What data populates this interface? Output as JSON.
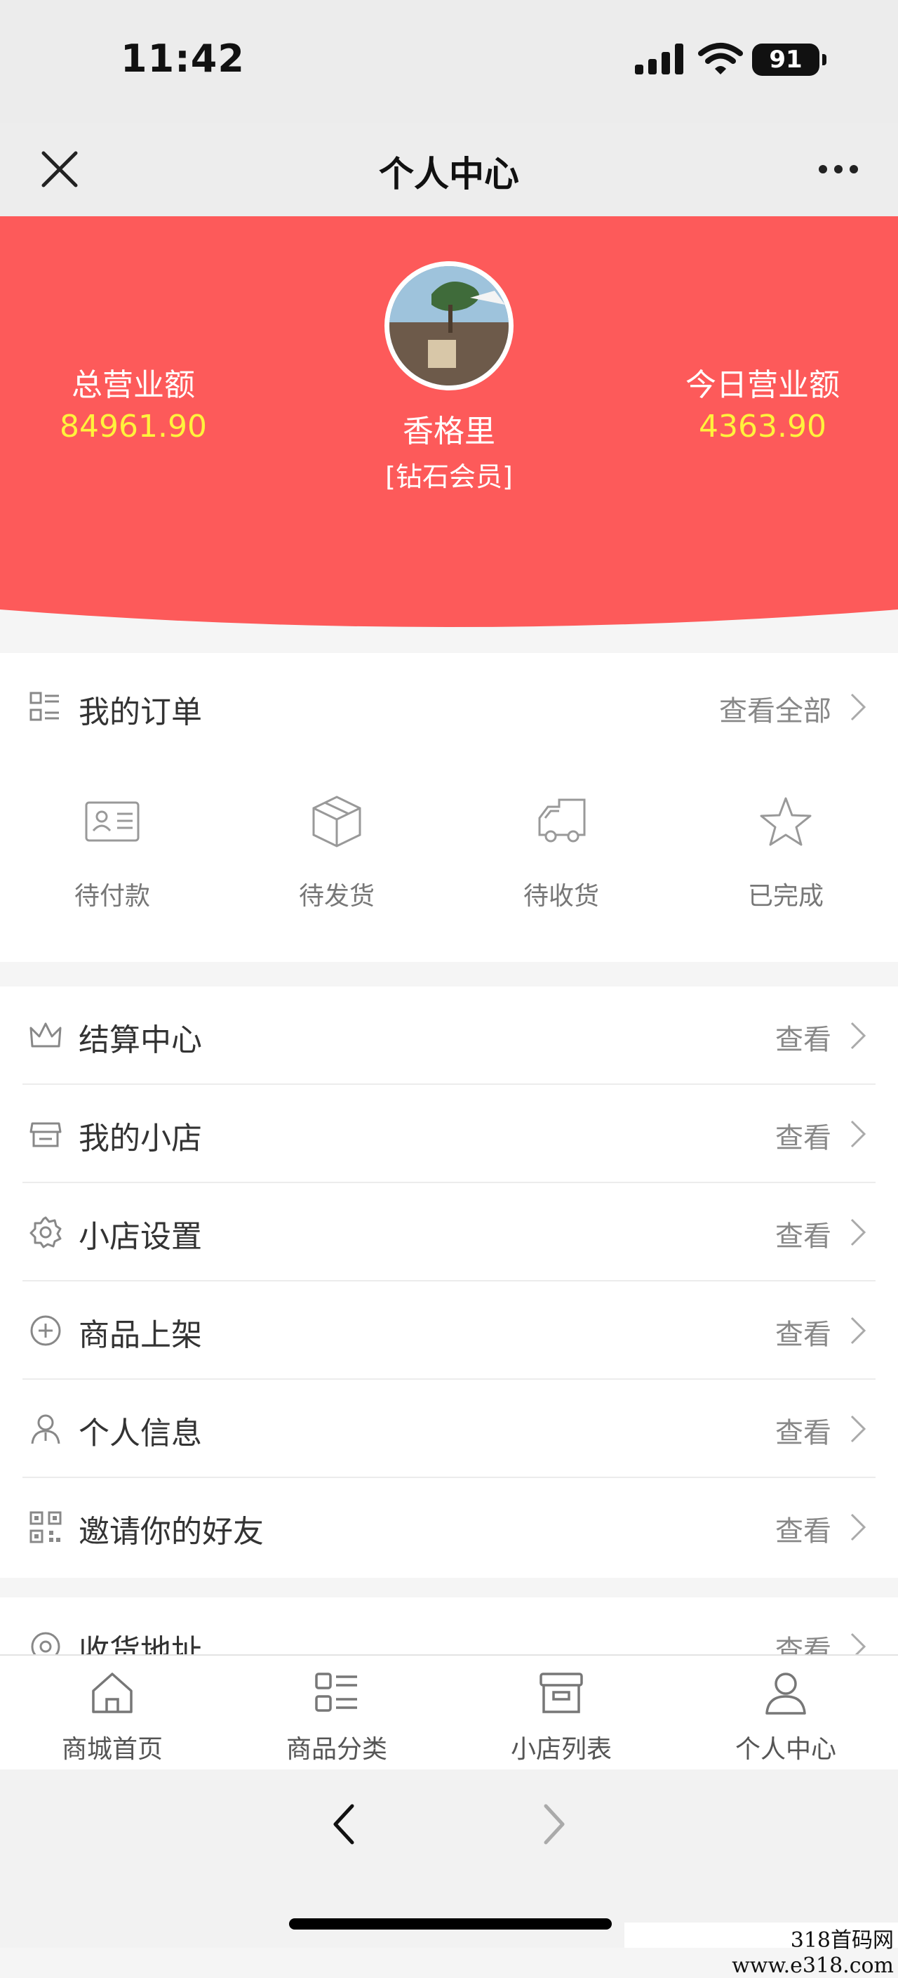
{
  "status_bar": {
    "time": "11:42",
    "battery": "91"
  },
  "nav": {
    "title": "个人中心"
  },
  "hero": {
    "total_label": "总营业额",
    "total_value": "84961.90",
    "today_label": "今日营业额",
    "today_value": "4363.90",
    "username": "香格里",
    "level": "[钻石会员]",
    "bg_color": "#fd5a5a",
    "value_color": "#fff23c"
  },
  "orders": {
    "title": "我的订单",
    "view_all": "查看全部",
    "items": [
      {
        "label": "待付款",
        "icon": "payment-card-icon"
      },
      {
        "label": "待发货",
        "icon": "box-icon"
      },
      {
        "label": "待收货",
        "icon": "truck-icon"
      },
      {
        "label": "已完成",
        "icon": "star-icon"
      }
    ]
  },
  "menu": {
    "items": [
      {
        "label": "结算中心",
        "link": "查看",
        "icon": "crown-icon"
      },
      {
        "label": "我的小店",
        "link": "查看",
        "icon": "store-icon"
      },
      {
        "label": "小店设置",
        "link": "查看",
        "icon": "gear-icon"
      },
      {
        "label": "商品上架",
        "link": "查看",
        "icon": "plus-circle-icon"
      },
      {
        "label": "个人信息",
        "link": "查看",
        "icon": "user-icon"
      },
      {
        "label": "邀请你的好友",
        "link": "查看",
        "icon": "qrcode-icon"
      }
    ]
  },
  "address": {
    "label": "收货地址",
    "link": "查看",
    "icon": "location-icon"
  },
  "tabbar": {
    "items": [
      {
        "label": "商城首页",
        "icon": "home-icon"
      },
      {
        "label": "商品分类",
        "icon": "category-icon"
      },
      {
        "label": "小店列表",
        "icon": "shop-list-icon"
      },
      {
        "label": "个人中心",
        "icon": "user-icon"
      }
    ]
  },
  "watermark": "318首码网 www.e318.com"
}
